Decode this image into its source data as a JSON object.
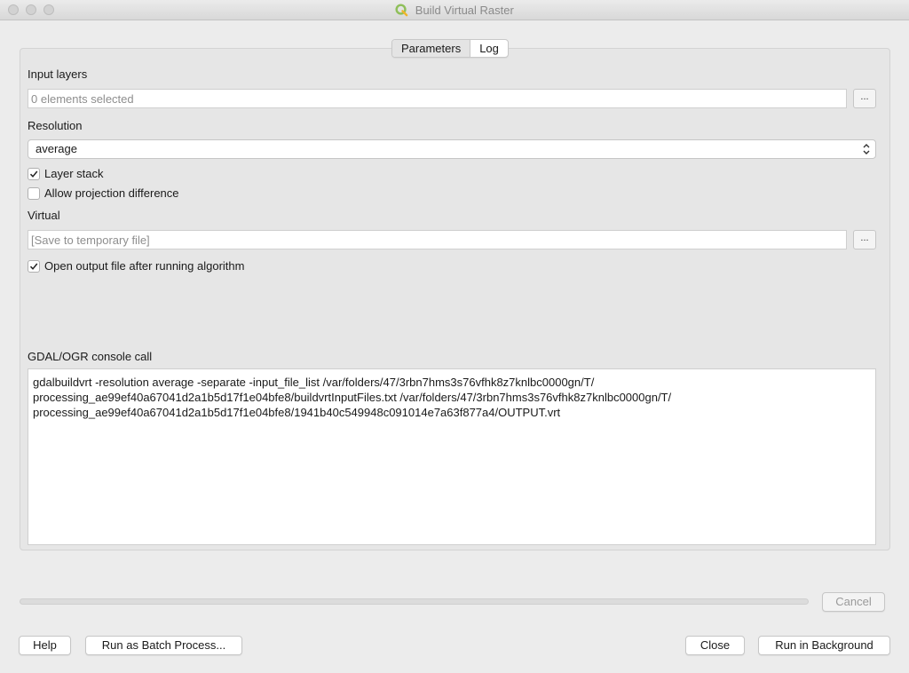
{
  "window": {
    "title": "Build Virtual Raster"
  },
  "tabs": [
    {
      "label": "Parameters"
    },
    {
      "label": "Log"
    }
  ],
  "form": {
    "input_layers_label": "Input layers",
    "input_layers_value": "0 elements selected",
    "resolution_label": "Resolution",
    "resolution_value": "average",
    "layer_stack_label": "Layer stack",
    "layer_stack_checked": true,
    "allow_projection_label": "Allow projection difference",
    "allow_projection_checked": false,
    "virtual_label": "Virtual",
    "virtual_placeholder": "[Save to temporary file]",
    "open_output_label": "Open output file after running algorithm",
    "open_output_checked": true,
    "browse_label": "..."
  },
  "console": {
    "label": "GDAL/OGR console call",
    "text": "gdalbuildvrt -resolution average -separate -input_file_list /var/folders/47/3rbn7hms3s76vfhk8z7knlbc0000gn/T/\nprocessing_ae99ef40a67041d2a1b5d17f1e04bfe8/buildvrtInputFiles.txt /var/folders/47/3rbn7hms3s76vfhk8z7knlbc0000gn/T/\nprocessing_ae99ef40a67041d2a1b5d17f1e04bfe8/1941b40c549948c091014e7a63f877a4/OUTPUT.vrt"
  },
  "progress": {
    "value": 0
  },
  "buttons": {
    "cancel": "Cancel",
    "help": "Help",
    "batch": "Run as Batch Process...",
    "close": "Close",
    "run_background": "Run in Background"
  },
  "colors": {
    "qgis_green": "#589632",
    "qgis_yellow": "#ee7913"
  }
}
